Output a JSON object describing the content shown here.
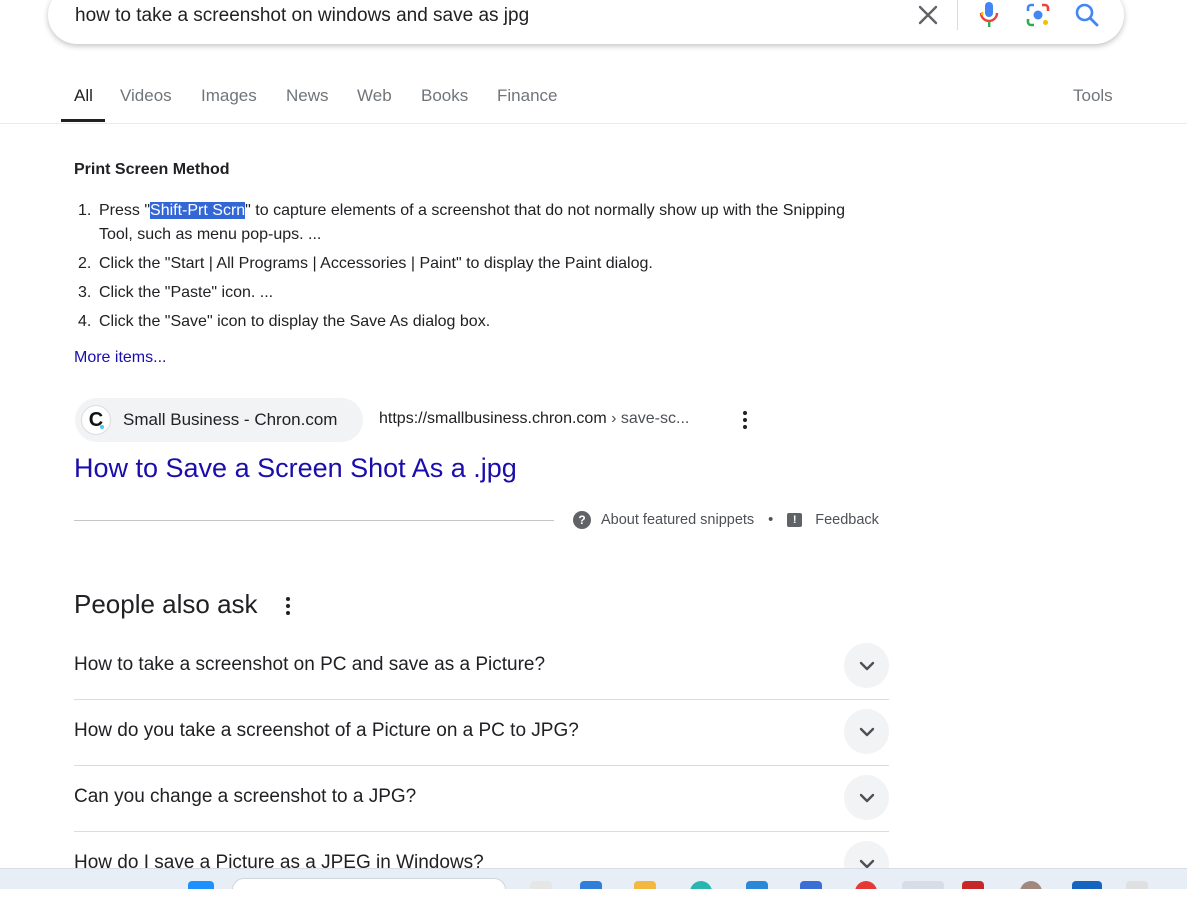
{
  "search": {
    "query": "how to take a screenshot on windows and save as jpg",
    "icons": [
      "close-icon",
      "microphone-icon",
      "lens-icon",
      "search-icon"
    ]
  },
  "tabs": [
    {
      "label": "All",
      "active": true
    },
    {
      "label": "Videos"
    },
    {
      "label": "Images"
    },
    {
      "label": "News"
    },
    {
      "label": "Web"
    },
    {
      "label": "Books"
    },
    {
      "label": "Finance"
    }
  ],
  "tools_label": "Tools",
  "snippet": {
    "title": "Print Screen Method",
    "steps": [
      {
        "num": "1.",
        "pre": "Press \"",
        "highlight": "Shift-Prt Scrn",
        "post": "\" to capture elements of a screenshot that do not normally show up with the Snipping Tool, such as menu pop-ups. ..."
      },
      {
        "num": "2.",
        "text": "Click the \"Start | All Programs | Accessories | Paint\" to display the Paint dialog."
      },
      {
        "num": "3.",
        "text": "Click the \"Paste\" icon. ..."
      },
      {
        "num": "4.",
        "text": "Click the \"Save\" icon to display the Save As dialog box."
      }
    ],
    "more_items": "More items...",
    "source": {
      "favicon_letter": "C",
      "name": "Small Business - Chron.com",
      "url": "https://smallbusiness.chron.com",
      "crumb": " › save-sc..."
    },
    "result_title": "How to Save a Screen Shot As a .jpg",
    "about": "About featured snippets",
    "bullet": "•",
    "feedback": "Feedback"
  },
  "paa": {
    "title": "People also ask",
    "questions": [
      "How to take a screenshot on PC and save as a Picture?",
      "How do you take a screenshot of a Picture on a PC to JPG?",
      "Can you change a screenshot to a JPG?",
      "How do I save a Picture as a JPEG in Windows?"
    ]
  },
  "colors": {
    "link": "#1a0dab",
    "highlight": "#3367d6",
    "google_blue": "#4285f4",
    "google_red": "#ea4335",
    "google_yellow": "#fbbc04",
    "google_green": "#34a853"
  }
}
